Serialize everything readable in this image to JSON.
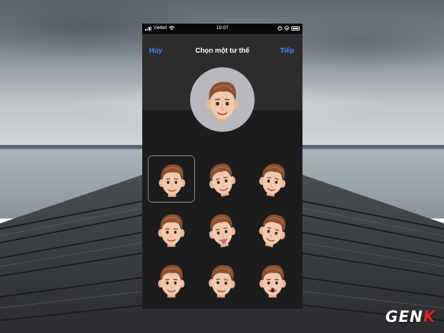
{
  "status_bar": {
    "carrier": "Viettel",
    "time": "10:07"
  },
  "nav": {
    "cancel_label": "Hủy",
    "title": "Chọn một tư thế",
    "next_label": "Tiếp"
  },
  "icons": {
    "signal": "signal-bars-icon",
    "wifi": "wifi-icon",
    "alarm": "alarm-icon",
    "lock_rotation": "orientation-lock-icon",
    "battery": "battery-icon"
  },
  "poses": [
    {
      "expression": "smile",
      "selected": true
    },
    {
      "expression": "wink-grin",
      "selected": false
    },
    {
      "expression": "smile-tilt",
      "selected": false
    },
    {
      "expression": "content",
      "selected": false
    },
    {
      "expression": "wink-tongue",
      "selected": false
    },
    {
      "expression": "side-glance",
      "selected": false
    },
    {
      "expression": "neutral",
      "selected": false
    },
    {
      "expression": "smirk",
      "selected": false
    },
    {
      "expression": "surprised",
      "selected": false
    }
  ],
  "colors": {
    "accent": "#3f8cff",
    "screen_bg": "#1c1c1e",
    "header_bg": "#2c2c2e",
    "preview_circle": "#b8b8bd",
    "skin": "#f2c9ad",
    "hair": "#8a5132"
  },
  "watermark": "GENK"
}
